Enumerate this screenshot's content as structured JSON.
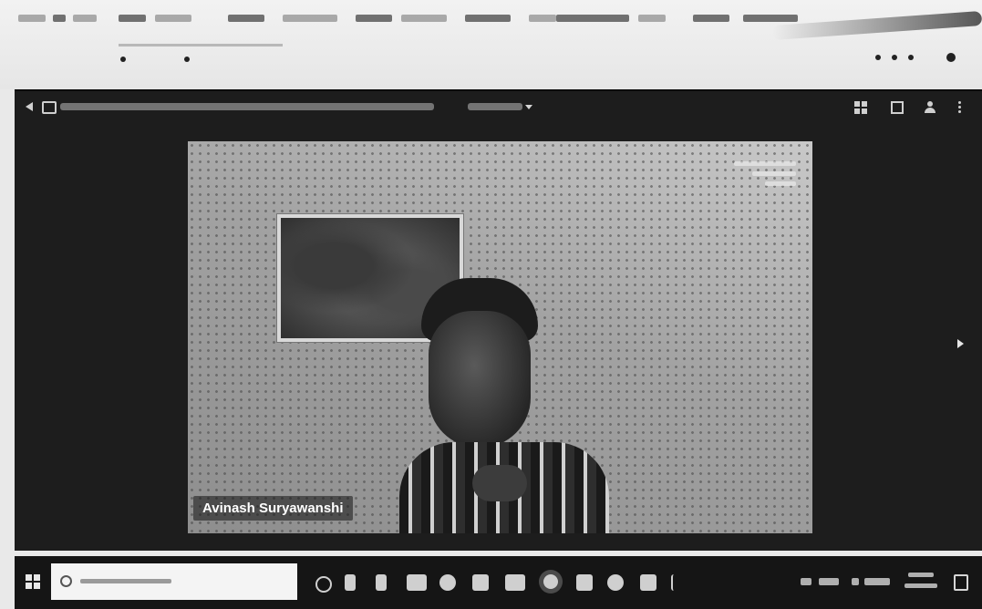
{
  "browser": {
    "bookmark_labels": [],
    "address": ""
  },
  "meeting": {
    "title": "",
    "layout_menu_label": "",
    "participant": {
      "name": "Avinash Suryawanshi"
    },
    "icons": {
      "back": "back-arrow-icon",
      "meeting": "meeting-icon",
      "grid": "grid-view-icon",
      "layout": "layout-icon",
      "participants": "participants-icon",
      "more": "more-options-icon",
      "next": "next-page-icon"
    }
  },
  "taskbar": {
    "search_placeholder": "",
    "clock_time": "",
    "clock_date": "",
    "icons": [
      "start-icon",
      "search-icon",
      "task-view-icon",
      "app-icon",
      "app-icon",
      "app-icon",
      "app-icon",
      "app-icon",
      "app-icon",
      "app-icon",
      "app-icon",
      "app-icon",
      "app-icon",
      "notification-icon"
    ]
  },
  "colors": {
    "meeting_background": "#1d1d1d",
    "taskbar_background": "#151515",
    "name_label_text": "#ffffff"
  }
}
